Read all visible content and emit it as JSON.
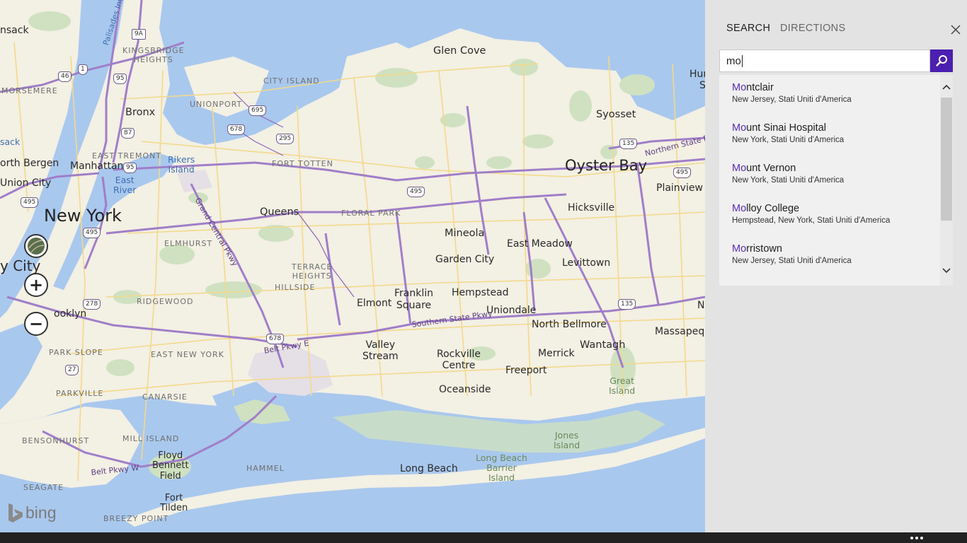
{
  "map": {
    "labels": {
      "new_york": "New York",
      "oyster_bay": "Oyster Bay",
      "queens": "Queens",
      "bronx": "Bronx",
      "manhattan": "Manhattan",
      "north_bergen": "orth Bergen",
      "union_city": "Union City",
      "nsack": "nsack",
      "city_frag": "y City",
      "brooklyn": "ooklyn",
      "sack": "sack",
      "glen_cove": "Glen Cove",
      "syosset": "Syosset",
      "hicksville": "Hicksville",
      "plainview": "Plainview",
      "mineola": "Mineola",
      "garden_city": "Garden City",
      "east_meadow": "East Meadow",
      "levittown": "Levittown",
      "hempstead": "Hempstead",
      "uniondale": "Uniondale",
      "franklin_square": "Franklin\nSquare",
      "elmont": "Elmont",
      "north_bellmore": "North Bellmore",
      "wantagh": "Wantagh",
      "massapequa": "Massapequ",
      "valley_stream": "Valley\nStream",
      "rockville_centre": "Rockville\nCentre",
      "merrick": "Merrick",
      "freeport": "Freeport",
      "oceanside": "Oceanside",
      "long_beach": "Long Beach",
      "floyd_bennett": "Floyd\nBennett\nField",
      "fort_tilden": "Fort\nTilden",
      "hun": "Hun",
      "s_frag": "S",
      "n_frag": "N",
      "hoods": {
        "kingsbridge": "KINGSBRIDGE\nHEIGHTS",
        "morsemere": "MORSEMERE",
        "city_island": "CITY ISLAND",
        "unionport": "UNIONPORT",
        "east_tremont": "EAST TREMONT",
        "fort_totten": "FORT TOTTEN",
        "floral_park": "FLORAL PARK",
        "elmhurst": "ELMHURST",
        "terrace_heights": "TERRACE\nHEIGHTS",
        "hillside": "HILLSIDE",
        "ridgewood": "RIDGEWOOD",
        "park_slope": "PARK SLOPE",
        "east_new_york": "EAST NEW YORK",
        "parkville": "PARKVILLE",
        "canarsie": "CANARSIE",
        "bensonhurst": "BENSONHURST",
        "mill_island": "MILL ISLAND",
        "hammel": "HAMMEL",
        "seagate": "SEAGATE",
        "breezy_point": "BREEZY POINT"
      },
      "water": {
        "rikers": "Rikers\nIsland",
        "east_river": "East\nRiver",
        "great_island": "Great\nIsland",
        "jones_island": "Jones\nIsland",
        "long_beach_barrier": "Long Beach\nBarrier\nIsland",
        "palisades": "Palisades Inte"
      },
      "roads": {
        "grand_central": "Grand Central Pkwy",
        "southern_state": "Southern State Pkwy",
        "belt_pkwy_e": "Belt Pkwy E",
        "belt_pkwy_w": "Belt Pkwy W",
        "northern_state": "Northern State P"
      },
      "shields": [
        "9A",
        "46",
        "1",
        "95",
        "87",
        "678",
        "695",
        "295",
        "495",
        "278",
        "495",
        "135",
        "495",
        "135",
        "678",
        "27",
        "95",
        "495"
      ]
    },
    "controls": {
      "zoom_in": "+",
      "zoom_out": "−",
      "map_style_icon": "globe-icon"
    },
    "brand": "bing"
  },
  "panel": {
    "tabs": [
      "SEARCH",
      "DIRECTIONS"
    ],
    "active_tab": "SEARCH",
    "close_icon": "close-icon",
    "search": {
      "value": "mo",
      "button_icon": "search-icon",
      "button_color": "#4b1fb0"
    },
    "results": [
      {
        "match": "Mo",
        "rest": "ntclair",
        "sub": "New Jersey, Stati Uniti d'America"
      },
      {
        "match": "Mo",
        "rest": "unt Sinai Hospital",
        "sub": "New York, Stati Uniti d'America"
      },
      {
        "match": "Mo",
        "rest": "unt Vernon",
        "sub": "New York, Stati Uniti d'America"
      },
      {
        "match": "Mo",
        "rest": "lloy College",
        "sub": "Hempstead, New York, Stati Uniti d'America"
      },
      {
        "match": "Mo",
        "rest": "rristown",
        "sub": "New Jersey, Stati Uniti d'America"
      }
    ],
    "highlight_color": "#5b2bb5"
  },
  "appbar": {
    "more_icon": "more-icon"
  }
}
